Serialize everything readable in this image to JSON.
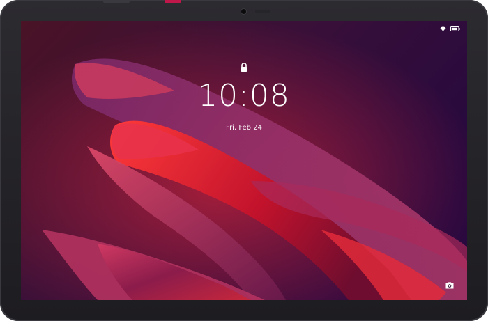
{
  "lockscreen": {
    "time": "10:08",
    "date": "Fri, Feb 24"
  },
  "status_bar": {
    "icons": [
      "wifi-icon",
      "battery-icon"
    ]
  },
  "shortcuts": {
    "camera_icon": "camera-icon"
  },
  "colors": {
    "bezel": "#2c2b30",
    "wallpaper_base": "#3e0f32",
    "accent_red": "#c8102e",
    "accent_magenta": "#b1306a",
    "text": "#ffffff"
  }
}
